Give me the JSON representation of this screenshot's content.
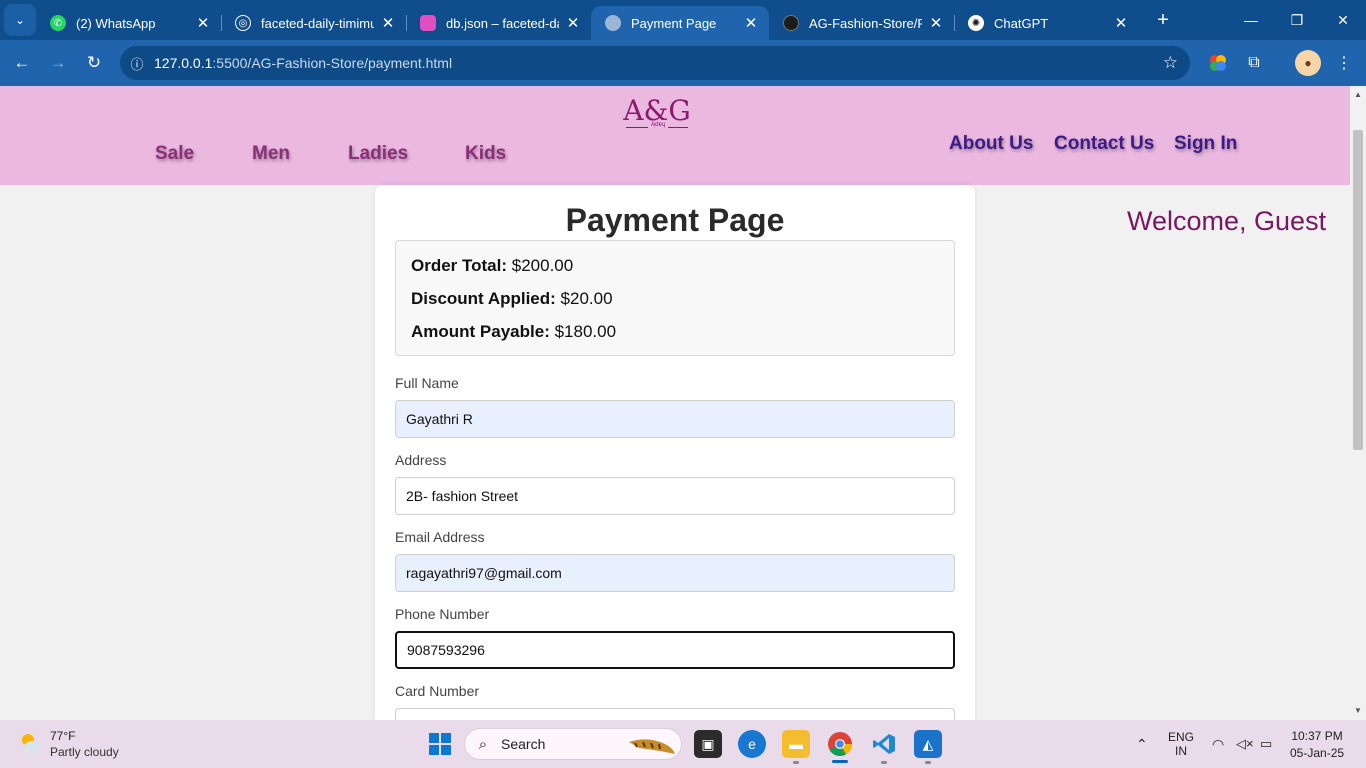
{
  "browser": {
    "tabs": [
      {
        "label": "(2) WhatsApp",
        "icon": "whatsapp-icon",
        "color": "#25d366"
      },
      {
        "label": "faceted-daily-timimus",
        "icon": "github-icon",
        "color": "#ffffff"
      },
      {
        "label": "db.json – faceted-dail",
        "icon": "glitch-icon",
        "color": "#e04ec2"
      },
      {
        "label": "Payment Page",
        "icon": "globe-icon",
        "color": "#9bb6d6"
      },
      {
        "label": "AG-Fashion-Store/RE",
        "icon": "github-icon",
        "color": "#ffffff"
      },
      {
        "label": "ChatGPT",
        "icon": "chatgpt-icon",
        "color": "#ffffff"
      }
    ],
    "url_host": "127.0.0.1",
    "url_path": ":5500/AG-Fashion-Store/payment.html"
  },
  "site": {
    "logo": "A&G",
    "logo_sub": "ʎᴉdɐɥ",
    "nav_left": [
      "Sale",
      "Men",
      "Ladies",
      "Kids"
    ],
    "nav_right": [
      "About Us",
      "Contact Us",
      "Sign In"
    ],
    "welcome": "Welcome, Guest"
  },
  "payment": {
    "title": "Payment Page",
    "order_total_label": "Order Total:",
    "order_total_value": "$200.00",
    "discount_label": "Discount Applied:",
    "discount_value": "$20.00",
    "payable_label": "Amount Payable:",
    "payable_value": "$180.00",
    "fields": [
      {
        "label": "Full Name",
        "value": "Gayathri R"
      },
      {
        "label": "Address",
        "value": "2B- fashion Street"
      },
      {
        "label": "Email Address",
        "value": "ragayathri97@gmail.com"
      },
      {
        "label": "Phone Number",
        "value": "9087593296"
      },
      {
        "label": "Card Number",
        "value": ""
      }
    ]
  },
  "taskbar": {
    "temperature": "77°F",
    "condition": "Partly cloudy",
    "search_placeholder": "Search",
    "lang": "ENG",
    "region": "IN",
    "time": "10:37 PM",
    "date": "05-Jan-25"
  },
  "colors": {
    "header_bg": "#ebb8e0",
    "brand": "#8a1a6e",
    "nav_right": "#3d1a8a",
    "tabbar": "#0f4d8c",
    "toolbar": "#1f64ad"
  }
}
